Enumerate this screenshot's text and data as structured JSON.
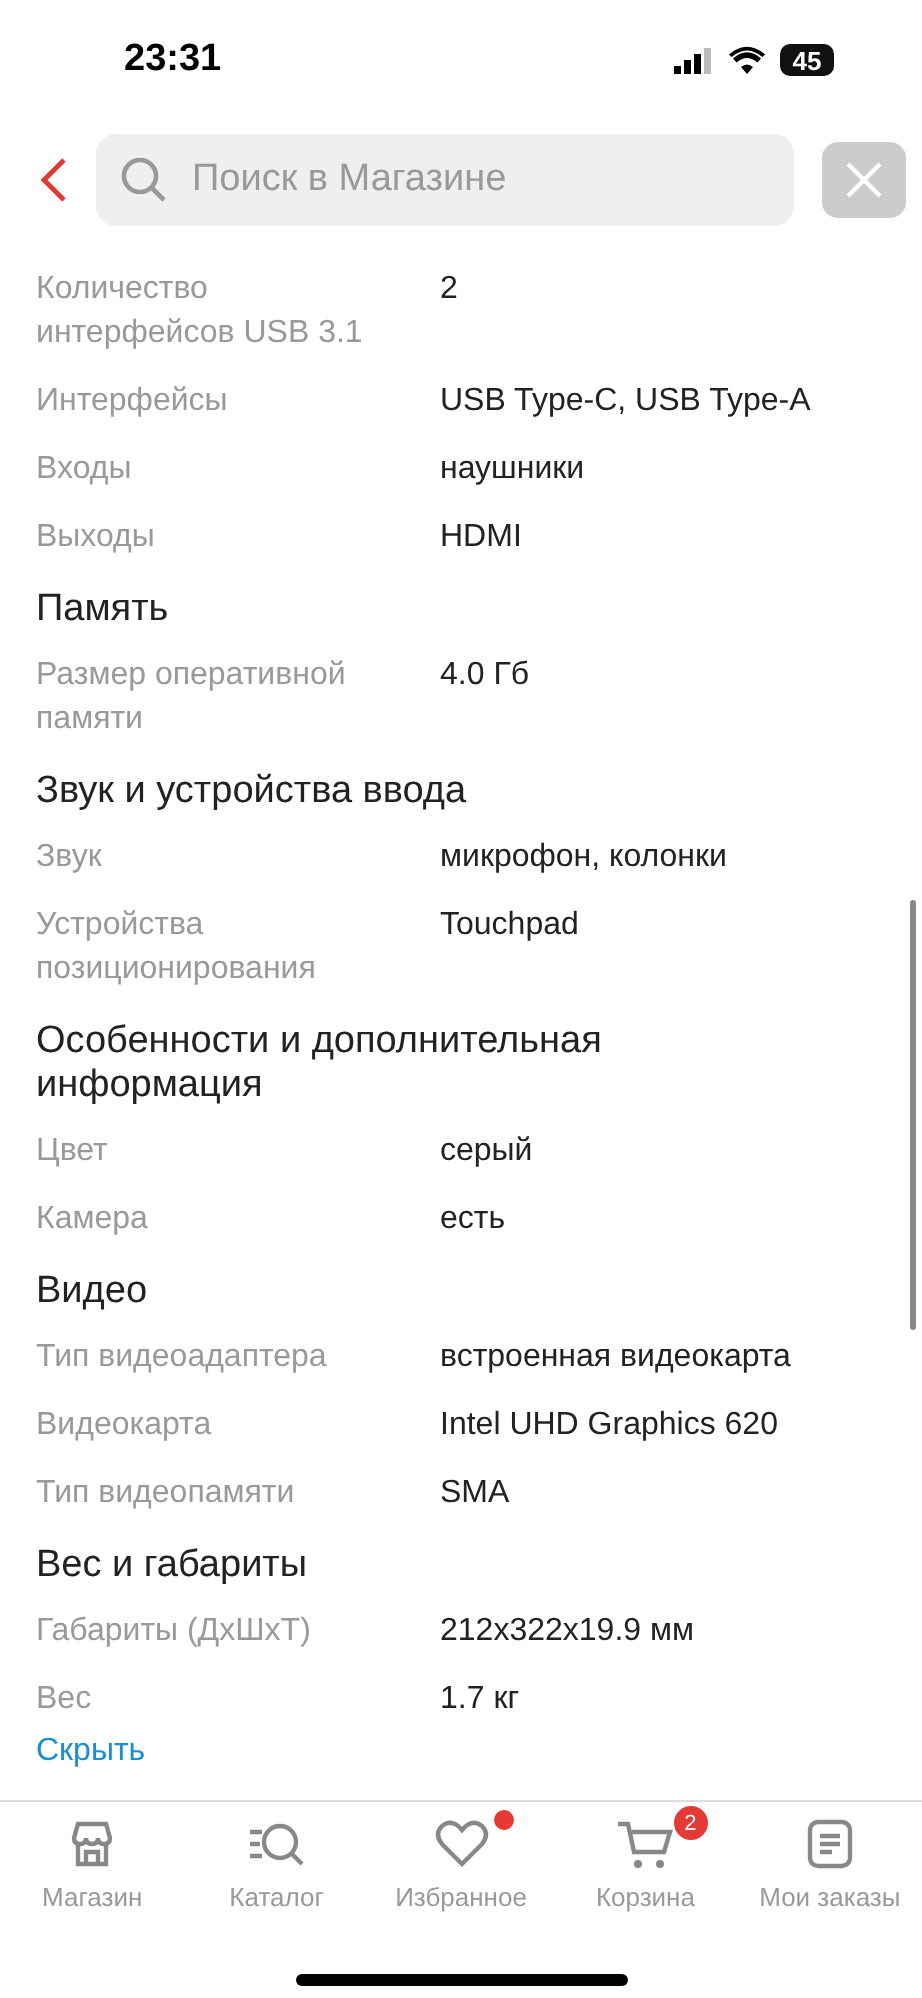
{
  "status_bar": {
    "time": "23:31",
    "battery": "45"
  },
  "search": {
    "placeholder": "Поиск в Магазине"
  },
  "specs": [
    {
      "kind": "row",
      "label": "Количество интерфейсов USB 3.1",
      "value": "2"
    },
    {
      "kind": "row",
      "label": "Интерфейсы",
      "value": "USB Type-C, USB Type-A"
    },
    {
      "kind": "row",
      "label": "Входы",
      "value": "наушники"
    },
    {
      "kind": "row",
      "label": "Выходы",
      "value": "HDMI"
    },
    {
      "kind": "heading",
      "label": "Память"
    },
    {
      "kind": "row",
      "label": "Размер оперативной памяти",
      "value": "4.0 Гб"
    },
    {
      "kind": "heading",
      "label": "Звук и устройства ввода"
    },
    {
      "kind": "row",
      "label": "Звук",
      "value": "микрофон, колонки"
    },
    {
      "kind": "row",
      "label": "Устройства позиционирования",
      "value": "Touchpad"
    },
    {
      "kind": "heading",
      "label": "Особенности и дополнительная информация"
    },
    {
      "kind": "row",
      "label": "Цвет",
      "value": "серый"
    },
    {
      "kind": "row",
      "label": "Камера",
      "value": "есть"
    },
    {
      "kind": "heading",
      "label": "Видео"
    },
    {
      "kind": "row",
      "label": "Тип видеоадаптера",
      "value": "встроенная видеокарта"
    },
    {
      "kind": "row",
      "label": "Видеокарта",
      "value": "Intel UHD Graphics 620"
    },
    {
      "kind": "row",
      "label": "Тип видеопамяти",
      "value": "SMA"
    },
    {
      "kind": "heading",
      "label": "Вес и габариты"
    },
    {
      "kind": "row",
      "label": "Габариты (ДxШxТ)",
      "value": "212x322x19.9 мм"
    },
    {
      "kind": "row",
      "label": "Вес",
      "value": "1.7 кг"
    }
  ],
  "hide_link": "Скрыть",
  "tab_bar": [
    {
      "label": "Магазин",
      "dot": false
    },
    {
      "label": "Каталог",
      "dot": false
    },
    {
      "label": "Избранное",
      "dot": true
    },
    {
      "label": "Корзина",
      "dot": false,
      "badge": "2"
    },
    {
      "label": "Мои заказы",
      "dot": false
    }
  ]
}
